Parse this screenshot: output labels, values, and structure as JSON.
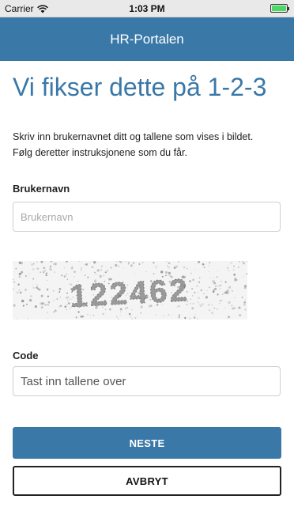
{
  "status_bar": {
    "carrier": "Carrier",
    "time": "1:03 PM",
    "battery_level": 1.0
  },
  "header": {
    "title": "HR-Portalen",
    "background_color": "#3a78a8"
  },
  "main": {
    "title": "Vi fikser dette på 1-2-3",
    "intro_line1": "Skriv inn brukernavnet ditt og tallene som vises i bildet.",
    "intro_line2": "Følg deretter instruksjonene som du får.",
    "username": {
      "label": "Brukernavn",
      "placeholder": "Brukernavn",
      "value": ""
    },
    "captcha": {
      "text": "122462"
    },
    "code": {
      "label": "Code",
      "placeholder": "Tast inn tallene over",
      "value": ""
    },
    "buttons": {
      "next": "NESTE",
      "cancel": "AVBRYT"
    }
  },
  "colors": {
    "accent": "#3a78a8",
    "battery": "#4cd964"
  },
  "icons": {
    "wifi": "wifi-icon",
    "battery": "battery-icon"
  }
}
